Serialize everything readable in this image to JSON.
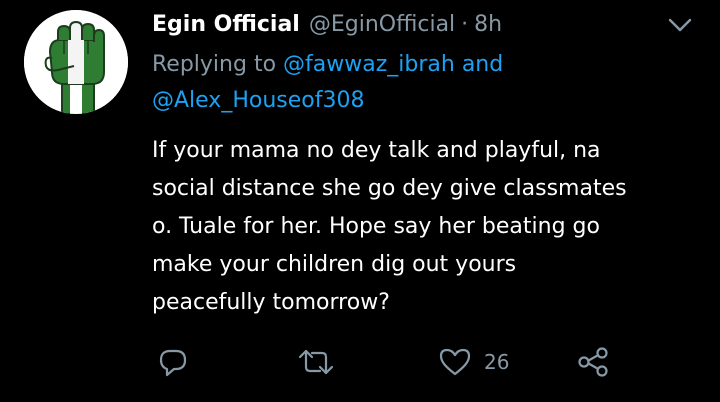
{
  "tweet": {
    "author_name": "Egin Official",
    "author_handle": "@EginOfficial",
    "separator": "·",
    "time": "8h",
    "replying_prefix": "Replying to",
    "mention_1": "@fawwaz_ibrah",
    "and_word": "and",
    "mention_2": "@Alex_Houseof308",
    "body_lines": [
      "If your mama no dey talk and playful, na",
      "social distance she go dey give classmates",
      "o. Tuale for her. Hope say her beating go",
      "make your children dig out yours",
      "peacefully tomorrow?"
    ],
    "like_count": "26"
  },
  "icons": {
    "avatar": "raised-fist-nigeria-flag-avatar",
    "caret": "chevron-down-icon",
    "reply": "reply-bubble-icon",
    "retweet": "retweet-arrows-icon",
    "like": "heart-icon",
    "share": "share-nodes-icon"
  },
  "colors": {
    "background": "#000000",
    "text": "#ffffff",
    "muted": "#8899a6",
    "link": "#1da1f2",
    "flag_green": "#2e7d32"
  }
}
